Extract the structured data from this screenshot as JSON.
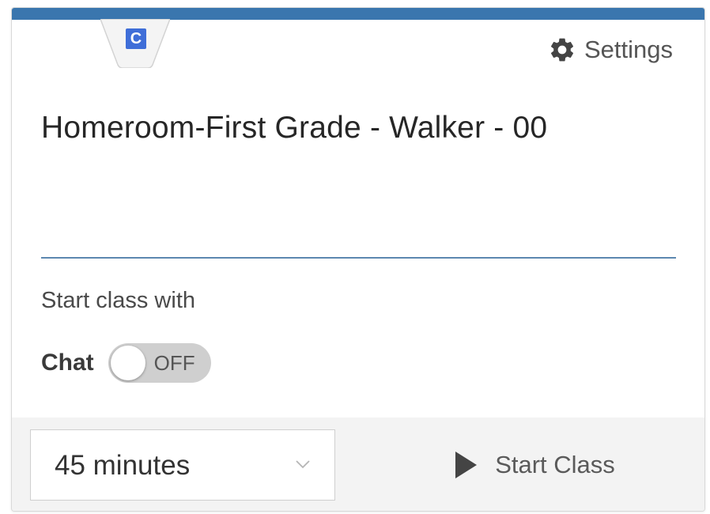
{
  "card": {
    "badge_letter": "C",
    "settings_label": "Settings",
    "title": "Homeroom-First Grade - Walker - 00",
    "start_with_label": "Start class with",
    "chat": {
      "label": "Chat",
      "toggle_state": "OFF"
    },
    "duration": {
      "selected": "45 minutes"
    },
    "start_button_label": "Start Class"
  },
  "colors": {
    "accent_bar": "#3a76ae",
    "badge": "#3f6ed8",
    "divider": "#5c88b0",
    "toggle_off": "#cfcfcf"
  },
  "icons": [
    "gear-icon",
    "chevron-down-icon",
    "play-icon"
  ]
}
